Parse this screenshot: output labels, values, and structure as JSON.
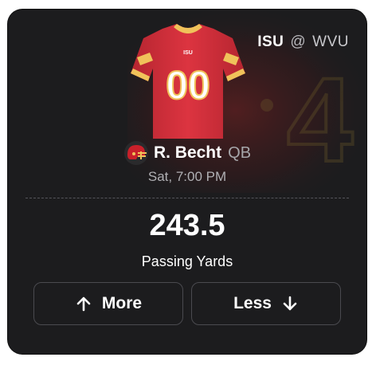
{
  "matchup": {
    "home_team": "ISU",
    "separator": "@",
    "away_team": "WVU"
  },
  "jersey": {
    "number": "00",
    "chest_text": "ISU",
    "primary_color": "#d12f3a",
    "accent_color": "#f0c25a"
  },
  "player": {
    "name": "R. Becht",
    "position": "QB",
    "helmet_icon": "football-helmet-icon",
    "helmet_color": "#c8202a"
  },
  "game": {
    "time": "Sat, 7:00 PM"
  },
  "projection": {
    "value": "243.5",
    "stat": "Passing Yards"
  },
  "actions": {
    "more_label": "More",
    "more_icon": "arrow-up-icon",
    "less_label": "Less",
    "less_icon": "arrow-down-icon"
  },
  "colors": {
    "card_background": "#1c1c1e",
    "text_primary": "#ffffff",
    "text_secondary": "#b0b0b4",
    "button_border": "#4a4a4f"
  }
}
